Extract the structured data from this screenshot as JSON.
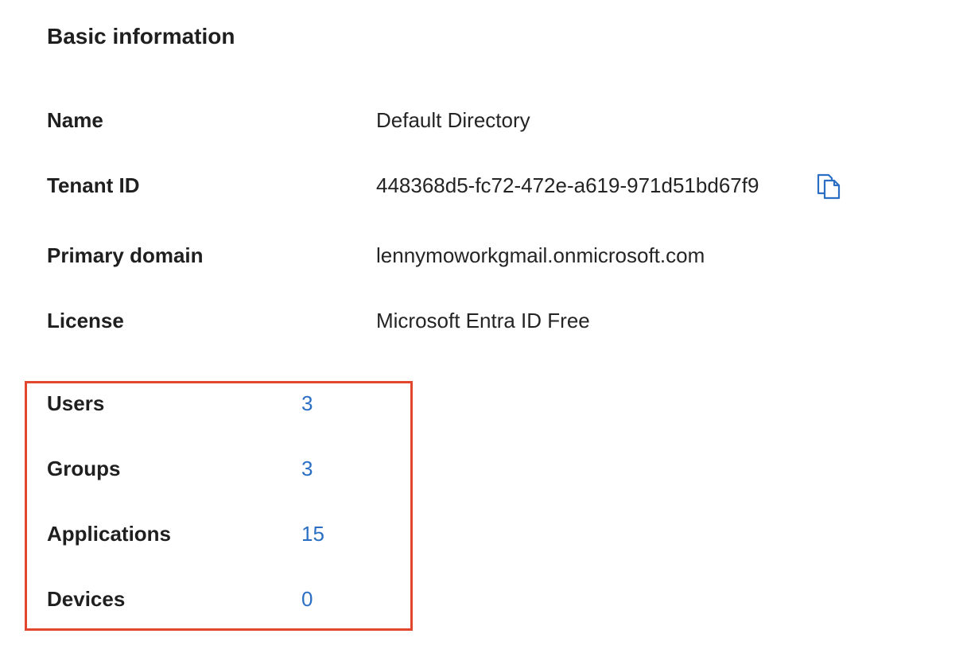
{
  "section": {
    "title": "Basic information"
  },
  "details": [
    {
      "label": "Name",
      "value": "Default Directory"
    },
    {
      "label": "Tenant ID",
      "value": "448368d5-fc72-472e-a619-971d51bd67f9",
      "copy_icon": "copy-icon"
    },
    {
      "label": "Primary domain",
      "value": "lennymoworkgmail.onmicrosoft.com"
    },
    {
      "label": "License",
      "value": "Microsoft Entra ID Free"
    }
  ],
  "counts": [
    {
      "label": "Users",
      "value": "3"
    },
    {
      "label": "Groups",
      "value": "3"
    },
    {
      "label": "Applications",
      "value": "15"
    },
    {
      "label": "Devices",
      "value": "0"
    }
  ],
  "colors": {
    "link": "#2b6fc4",
    "highlight_border": "#e2462f",
    "copy_icon": "#2b6fc4"
  }
}
